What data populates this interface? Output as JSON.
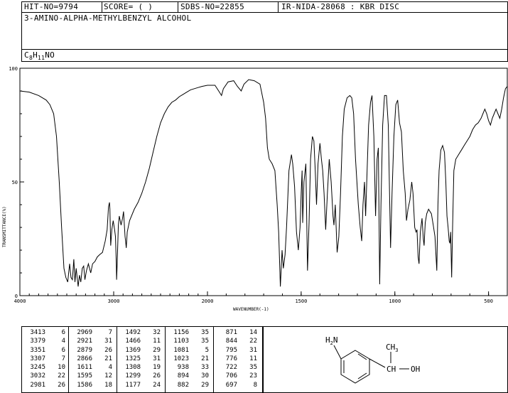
{
  "header": {
    "hit_no": "HIT-NO=9794",
    "score": "SCORE=  (   )",
    "sdbs_no": "SDBS-NO=22855",
    "ir_info": "IR-NIDA-28068 : KBR DISC",
    "compound_name": "3-AMINO-ALPHA-METHYLBENZYL ALCOHOL",
    "formula_base": "C",
    "formula_c": "8",
    "formula_h_letter": "H",
    "formula_h": "11",
    "formula_rest": "NO"
  },
  "chart_data": {
    "type": "line",
    "title": "",
    "xlabel": "WAVENUMBER(-1)",
    "ylabel": "TRANSMITTANCE(%)",
    "xlim": [
      4000,
      400
    ],
    "ylim": [
      0,
      100
    ],
    "x_ticks": [
      "4000",
      "3000",
      "2000",
      "1500",
      "1000",
      "500"
    ],
    "y_ticks": [
      "100",
      "50",
      "0"
    ],
    "grid": false,
    "series": [
      {
        "points": [
          [
            4000,
            90
          ],
          [
            3900,
            89.5
          ],
          [
            3800,
            88
          ],
          [
            3720,
            86
          ],
          [
            3680,
            84
          ],
          [
            3640,
            80
          ],
          [
            3610,
            70
          ],
          [
            3580,
            50
          ],
          [
            3555,
            30
          ],
          [
            3530,
            12
          ],
          [
            3510,
            8
          ],
          [
            3490,
            6
          ],
          [
            3470,
            14
          ],
          [
            3455,
            8
          ],
          [
            3440,
            7
          ],
          [
            3425,
            16
          ],
          [
            3413,
            6
          ],
          [
            3400,
            12
          ],
          [
            3379,
            4
          ],
          [
            3365,
            9
          ],
          [
            3351,
            6
          ],
          [
            3335,
            12
          ],
          [
            3320,
            13
          ],
          [
            3307,
            7
          ],
          [
            3290,
            11
          ],
          [
            3270,
            14
          ],
          [
            3245,
            10
          ],
          [
            3225,
            14
          ],
          [
            3200,
            15
          ],
          [
            3175,
            17
          ],
          [
            3150,
            18
          ],
          [
            3120,
            19
          ],
          [
            3090,
            24
          ],
          [
            3070,
            29
          ],
          [
            3055,
            39
          ],
          [
            3045,
            41
          ],
          [
            3040,
            38
          ],
          [
            3032,
            22
          ],
          [
            3020,
            29
          ],
          [
            3005,
            33
          ],
          [
            2990,
            29
          ],
          [
            2981,
            26
          ],
          [
            2972,
            14
          ],
          [
            2969,
            7
          ],
          [
            2965,
            11
          ],
          [
            2950,
            31
          ],
          [
            2940,
            35
          ],
          [
            2921,
            31
          ],
          [
            2905,
            34
          ],
          [
            2895,
            37
          ],
          [
            2879,
            26
          ],
          [
            2873,
            24
          ],
          [
            2866,
            21
          ],
          [
            2855,
            28
          ],
          [
            2830,
            33
          ],
          [
            2780,
            38
          ],
          [
            2740,
            41
          ],
          [
            2700,
            45
          ],
          [
            2660,
            50
          ],
          [
            2620,
            56
          ],
          [
            2580,
            63
          ],
          [
            2540,
            70
          ],
          [
            2500,
            76
          ],
          [
            2460,
            80
          ],
          [
            2420,
            83
          ],
          [
            2380,
            85
          ],
          [
            2340,
            86
          ],
          [
            2300,
            87.5
          ],
          [
            2260,
            88.5
          ],
          [
            2220,
            89.5
          ],
          [
            2180,
            90.5
          ],
          [
            2140,
            91
          ],
          [
            2100,
            91.5
          ],
          [
            2060,
            92
          ],
          [
            2000,
            92.5
          ],
          [
            1960,
            92.5
          ],
          [
            1940,
            90
          ],
          [
            1925,
            88
          ],
          [
            1915,
            91
          ],
          [
            1890,
            94
          ],
          [
            1860,
            94.5
          ],
          [
            1840,
            92
          ],
          [
            1820,
            90
          ],
          [
            1805,
            93
          ],
          [
            1780,
            95
          ],
          [
            1750,
            94.5
          ],
          [
            1720,
            93
          ],
          [
            1700,
            85
          ],
          [
            1690,
            78
          ],
          [
            1680,
            65
          ],
          [
            1670,
            60
          ],
          [
            1655,
            58
          ],
          [
            1640,
            55
          ],
          [
            1628,
            40
          ],
          [
            1620,
            28
          ],
          [
            1611,
            4
          ],
          [
            1602,
            20
          ],
          [
            1595,
            12
          ],
          [
            1586,
            18
          ],
          [
            1578,
            30
          ],
          [
            1565,
            55
          ],
          [
            1552,
            62
          ],
          [
            1545,
            58
          ],
          [
            1535,
            48
          ],
          [
            1525,
            28
          ],
          [
            1515,
            20
          ],
          [
            1506,
            30
          ],
          [
            1500,
            45
          ],
          [
            1495,
            55
          ],
          [
            1492,
            32
          ],
          [
            1485,
            50
          ],
          [
            1475,
            58
          ],
          [
            1466,
            11
          ],
          [
            1458,
            32
          ],
          [
            1450,
            60
          ],
          [
            1440,
            70
          ],
          [
            1432,
            68
          ],
          [
            1425,
            55
          ],
          [
            1418,
            40
          ],
          [
            1410,
            58
          ],
          [
            1400,
            67
          ],
          [
            1392,
            60
          ],
          [
            1385,
            55
          ],
          [
            1378,
            45
          ],
          [
            1369,
            29
          ],
          [
            1360,
            45
          ],
          [
            1350,
            60
          ],
          [
            1340,
            50
          ],
          [
            1330,
            35
          ],
          [
            1325,
            31
          ],
          [
            1318,
            40
          ],
          [
            1308,
            19
          ],
          [
            1300,
            25
          ],
          [
            1299,
            26
          ],
          [
            1290,
            45
          ],
          [
            1280,
            70
          ],
          [
            1270,
            82
          ],
          [
            1255,
            87
          ],
          [
            1240,
            88
          ],
          [
            1230,
            87
          ],
          [
            1220,
            80
          ],
          [
            1210,
            60
          ],
          [
            1195,
            40
          ],
          [
            1185,
            30
          ],
          [
            1177,
            24
          ],
          [
            1170,
            40
          ],
          [
            1162,
            50
          ],
          [
            1156,
            35
          ],
          [
            1148,
            55
          ],
          [
            1140,
            75
          ],
          [
            1130,
            85
          ],
          [
            1122,
            88
          ],
          [
            1112,
            70
          ],
          [
            1103,
            35
          ],
          [
            1095,
            60
          ],
          [
            1088,
            65
          ],
          [
            1081,
            5
          ],
          [
            1074,
            40
          ],
          [
            1065,
            75
          ],
          [
            1055,
            88
          ],
          [
            1045,
            88
          ],
          [
            1035,
            75
          ],
          [
            1023,
            21
          ],
          [
            1015,
            45
          ],
          [
            1005,
            70
          ],
          [
            995,
            84
          ],
          [
            985,
            86
          ],
          [
            975,
            76
          ],
          [
            965,
            72
          ],
          [
            955,
            55
          ],
          [
            945,
            45
          ],
          [
            938,
            33
          ],
          [
            930,
            38
          ],
          [
            920,
            42
          ],
          [
            910,
            50
          ],
          [
            903,
            45
          ],
          [
            894,
            30
          ],
          [
            887,
            28
          ],
          [
            882,
            29
          ],
          [
            876,
            17
          ],
          [
            871,
            14
          ],
          [
            864,
            28
          ],
          [
            855,
            34
          ],
          [
            848,
            25
          ],
          [
            844,
            22
          ],
          [
            838,
            32
          ],
          [
            830,
            36
          ],
          [
            820,
            38
          ],
          [
            805,
            36
          ],
          [
            795,
            31
          ],
          [
            786,
            26
          ],
          [
            776,
            11
          ],
          [
            770,
            40
          ],
          [
            764,
            55
          ],
          [
            755,
            64
          ],
          [
            745,
            66
          ],
          [
            735,
            63
          ],
          [
            728,
            50
          ],
          [
            722,
            35
          ],
          [
            716,
            30
          ],
          [
            710,
            24
          ],
          [
            706,
            23
          ],
          [
            702,
            28
          ],
          [
            697,
            8
          ],
          [
            692,
            30
          ],
          [
            685,
            55
          ],
          [
            675,
            60
          ],
          [
            660,
            62
          ],
          [
            645,
            64
          ],
          [
            630,
            66
          ],
          [
            615,
            68
          ],
          [
            600,
            70
          ],
          [
            585,
            73
          ],
          [
            570,
            75
          ],
          [
            555,
            76
          ],
          [
            540,
            78
          ],
          [
            530,
            80
          ],
          [
            520,
            82
          ],
          [
            510,
            80
          ],
          [
            500,
            77
          ],
          [
            490,
            75
          ],
          [
            480,
            78
          ],
          [
            470,
            80
          ],
          [
            460,
            82
          ],
          [
            450,
            80
          ],
          [
            440,
            78
          ],
          [
            430,
            82
          ],
          [
            420,
            87
          ],
          [
            410,
            91
          ],
          [
            400,
            92
          ]
        ]
      }
    ]
  },
  "peaks": [
    [
      [
        "3413",
        "6"
      ],
      [
        "3379",
        "4"
      ],
      [
        "3351",
        "6"
      ],
      [
        "3307",
        "7"
      ],
      [
        "3245",
        "10"
      ],
      [
        "3032",
        "22"
      ],
      [
        "2981",
        "26"
      ]
    ],
    [
      [
        "2969",
        "7"
      ],
      [
        "2921",
        "31"
      ],
      [
        "2879",
        "26"
      ],
      [
        "2866",
        "21"
      ],
      [
        "1611",
        "4"
      ],
      [
        "1595",
        "12"
      ],
      [
        "1586",
        "18"
      ]
    ],
    [
      [
        "1492",
        "32"
      ],
      [
        "1466",
        "11"
      ],
      [
        "1369",
        "29"
      ],
      [
        "1325",
        "31"
      ],
      [
        "1308",
        "19"
      ],
      [
        "1299",
        "26"
      ],
      [
        "1177",
        "24"
      ]
    ],
    [
      [
        "1156",
        "35"
      ],
      [
        "1103",
        "35"
      ],
      [
        "1081",
        "5"
      ],
      [
        "1023",
        "21"
      ],
      [
        "938",
        "33"
      ],
      [
        "894",
        "30"
      ],
      [
        "882",
        "29"
      ]
    ],
    [
      [
        "871",
        "14"
      ],
      [
        "844",
        "22"
      ],
      [
        "795",
        "31"
      ],
      [
        "776",
        "11"
      ],
      [
        "722",
        "35"
      ],
      [
        "706",
        "23"
      ],
      [
        "697",
        "8"
      ]
    ]
  ],
  "structure": {
    "amine_label_h": "H",
    "amine_label_sub": "2",
    "amine_label_n": "N",
    "methyl_label": "CH",
    "methyl_sub": "3",
    "ch_label": "CH",
    "oh_label": "OH"
  }
}
